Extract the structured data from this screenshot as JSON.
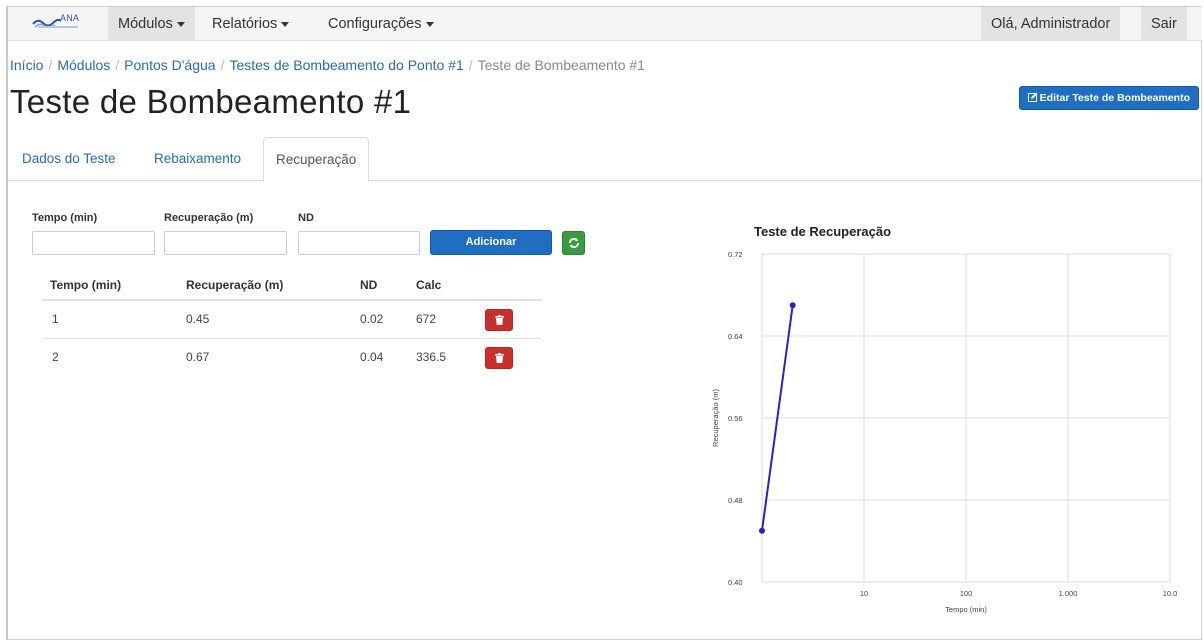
{
  "navbar": {
    "brand": "ANA",
    "menu": [
      {
        "label": "Módulos"
      },
      {
        "label": "Relatórios"
      },
      {
        "label": "Configurações"
      }
    ],
    "greeting": "Olá, Administrador",
    "logout": "Sair"
  },
  "breadcrumb": {
    "items": [
      "Início",
      "Módulos",
      "Pontos D'água",
      "Testes de Bombeamento do Ponto #1"
    ],
    "current": "Teste de Bombeamento #1"
  },
  "page": {
    "title": "Teste de Bombeamento #1",
    "edit_button": "Editar Teste de Bombeamento"
  },
  "tabs": [
    {
      "label": "Dados do Teste"
    },
    {
      "label": "Rebaixamento"
    },
    {
      "label": "Recuperação",
      "active": true
    }
  ],
  "form": {
    "tempo_label": "Tempo (min)",
    "recuperacao_label": "Recuperação (m)",
    "nd_label": "ND",
    "tempo_value": "",
    "recuperacao_value": "",
    "nd_value": "",
    "add_button": "Adicionar"
  },
  "table": {
    "headers": [
      "Tempo (min)",
      "Recuperação (m)",
      "ND",
      "Calc"
    ],
    "rows": [
      [
        "1",
        "0.45",
        "0.02",
        "672"
      ],
      [
        "2",
        "0.67",
        "0.04",
        "336.5"
      ]
    ]
  },
  "chart_data": {
    "type": "line",
    "title": "Teste de Recuperação",
    "xlabel": "Tempo (min)",
    "ylabel": "Recuperação (m)",
    "x_scale": "log",
    "x_ticks": [
      "10",
      "100",
      "1.000",
      "10.0"
    ],
    "y_ticks": [
      "0.40",
      "0.48",
      "0.56",
      "0.64",
      "0.72"
    ],
    "xlim": [
      1,
      10000
    ],
    "ylim": [
      0.4,
      0.72
    ],
    "grid": true,
    "series": [
      {
        "x": [
          1,
          2
        ],
        "y": [
          0.45,
          0.67
        ],
        "color": "#2323c8"
      }
    ]
  }
}
